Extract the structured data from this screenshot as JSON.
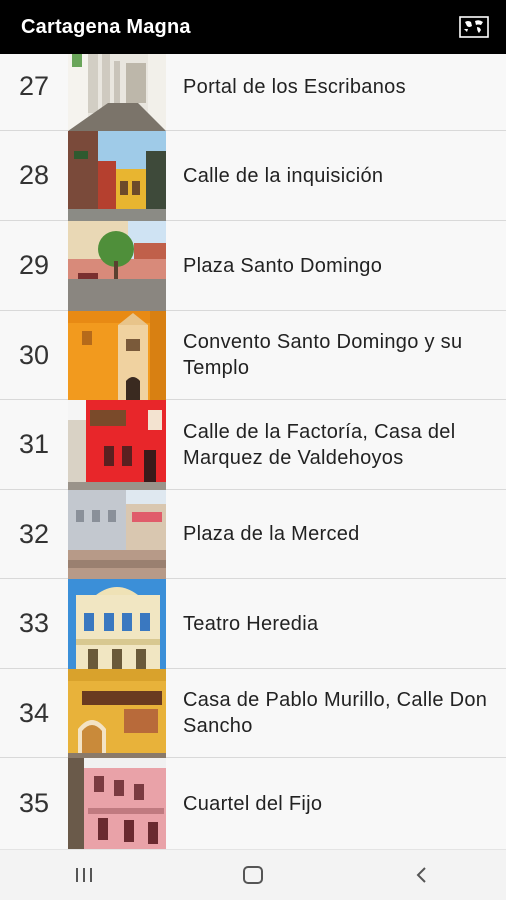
{
  "app": {
    "title": "Cartagena Magna"
  },
  "list": {
    "items": [
      {
        "number": "27",
        "name": "Portal de los Escribanos"
      },
      {
        "number": "28",
        "name": "Calle de la inquisición"
      },
      {
        "number": "29",
        "name": "Plaza Santo Domingo"
      },
      {
        "number": "30",
        "name": "Convento Santo Domingo y su Templo"
      },
      {
        "number": "31",
        "name": "Calle de la Factoría, Casa del Marquez de Valdehoyos"
      },
      {
        "number": "32",
        "name": "Plaza de la Merced"
      },
      {
        "number": "33",
        "name": "Teatro Heredia"
      },
      {
        "number": "34",
        "name": "Casa de Pablo Murillo, Calle Don Sancho"
      },
      {
        "number": "35",
        "name": "Cuartel del Fijo"
      }
    ]
  },
  "icons": {
    "map": "map-icon",
    "recents": "recent-apps-icon",
    "home": "home-icon",
    "back": "back-icon"
  },
  "colors": {
    "appbar": "#000000",
    "row_background": "#f8f8f8",
    "divider": "#d9d9d9",
    "navbar": "#f3f3f3"
  }
}
